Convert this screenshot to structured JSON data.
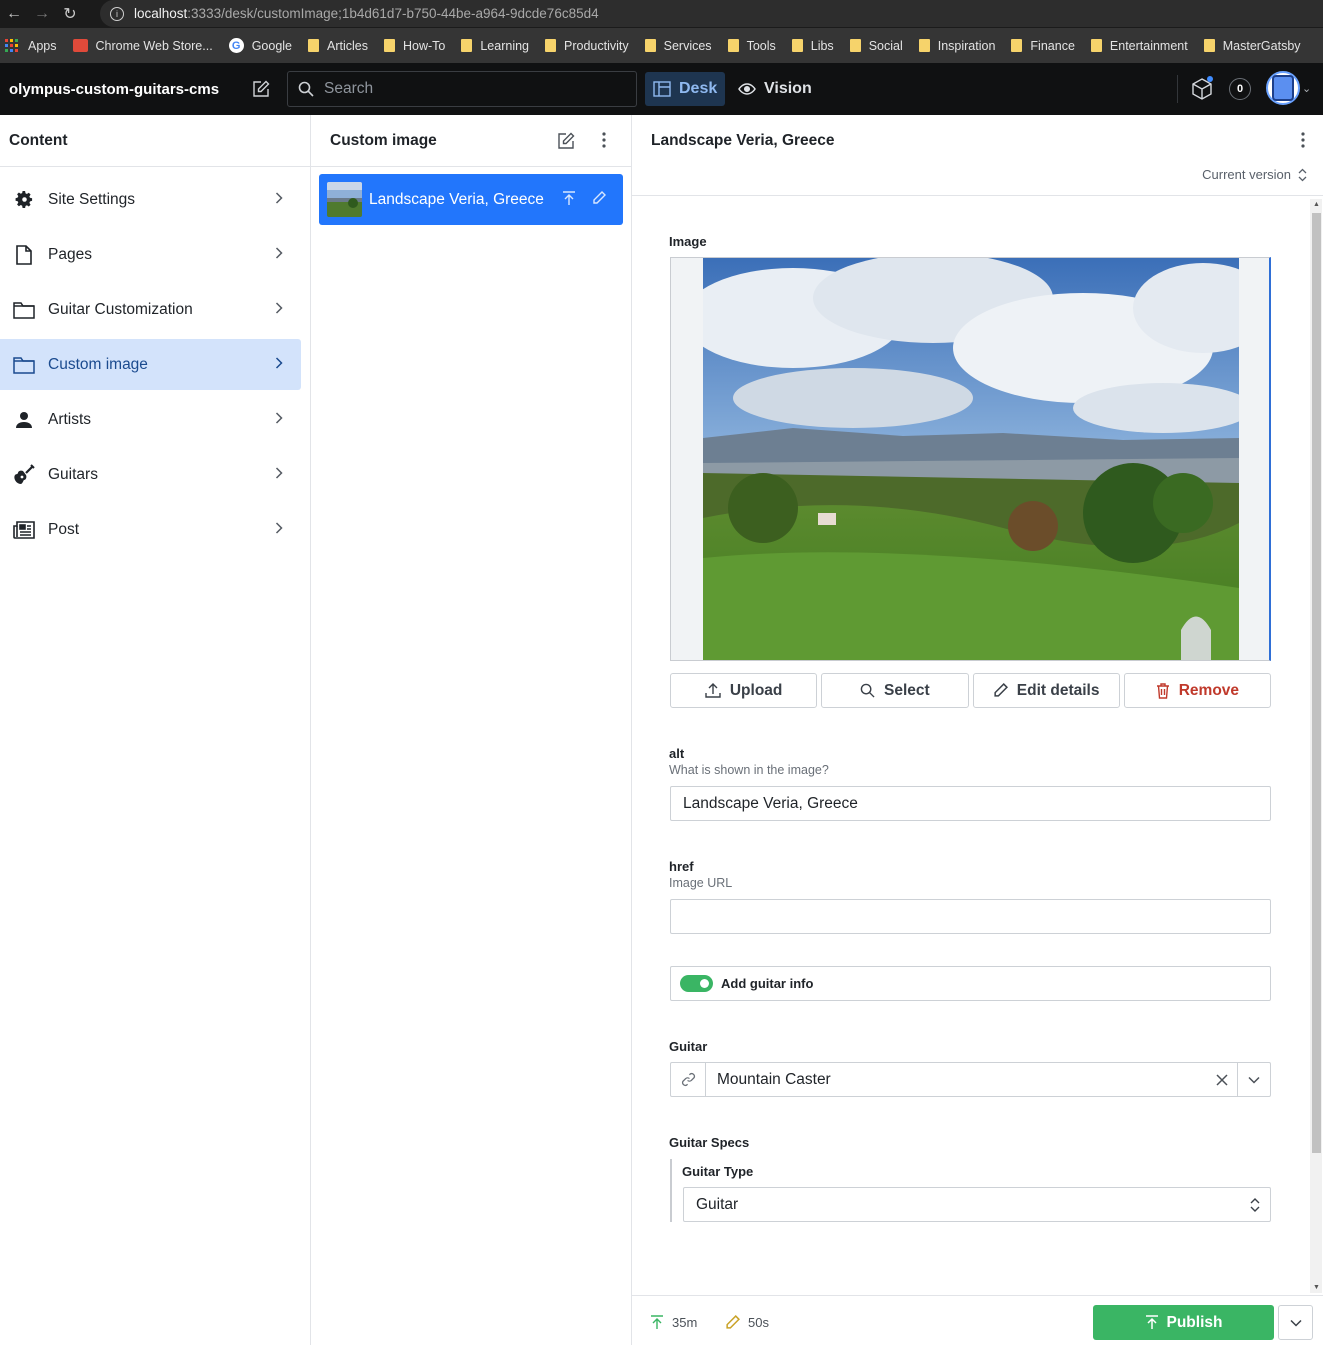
{
  "browser": {
    "url_host": "localhost",
    "url_rest": ":3333/desk/customImage;1b4d61d7-b750-44be-a964-9dcde76c85d4",
    "bookmarks": [
      {
        "label": "Apps",
        "icon": "apps-grid-icon"
      },
      {
        "label": "Chrome Web Store...",
        "icon": "chrome-store-icon"
      },
      {
        "label": "Google",
        "icon": "google-icon"
      },
      {
        "label": "Articles",
        "icon": "folder-icon"
      },
      {
        "label": "How-To",
        "icon": "folder-icon"
      },
      {
        "label": "Learning",
        "icon": "folder-icon"
      },
      {
        "label": "Productivity",
        "icon": "folder-icon"
      },
      {
        "label": "Services",
        "icon": "folder-icon"
      },
      {
        "label": "Tools",
        "icon": "folder-icon"
      },
      {
        "label": "Libs",
        "icon": "folder-icon"
      },
      {
        "label": "Social",
        "icon": "folder-icon"
      },
      {
        "label": "Inspiration",
        "icon": "folder-icon"
      },
      {
        "label": "Finance",
        "icon": "folder-icon"
      },
      {
        "label": "Entertainment",
        "icon": "folder-icon"
      },
      {
        "label": "MasterGatsby",
        "icon": "folder-icon"
      }
    ]
  },
  "appbar": {
    "brand": "olympus-custom-guitars-cms",
    "search_placeholder": "Search",
    "tools": [
      {
        "label": "Desk",
        "active": true
      },
      {
        "label": "Vision",
        "active": false
      }
    ],
    "notification_count": "0"
  },
  "content_pane": {
    "title": "Content",
    "items": [
      {
        "label": "Site Settings",
        "icon": "gear-icon",
        "active": false
      },
      {
        "label": "Pages",
        "icon": "document-icon",
        "active": false
      },
      {
        "label": "Guitar Customization",
        "icon": "folder-icon",
        "active": false
      },
      {
        "label": "Custom image",
        "icon": "folder-icon",
        "active": true
      },
      {
        "label": "Artists",
        "icon": "user-icon",
        "active": false
      },
      {
        "label": "Guitars",
        "icon": "guitar-icon",
        "active": false
      },
      {
        "label": "Post",
        "icon": "newspaper-icon",
        "active": false
      }
    ]
  },
  "list_pane": {
    "title": "Custom image",
    "documents": [
      {
        "title": "Landscape Veria, Greece",
        "selected": true
      }
    ]
  },
  "editor": {
    "title": "Landscape Veria, Greece",
    "version_label": "Current version",
    "image": {
      "label": "Image",
      "buttons": {
        "upload": "Upload",
        "select": "Select",
        "edit": "Edit details",
        "remove": "Remove"
      }
    },
    "alt": {
      "label": "alt",
      "description": "What is shown in the image?",
      "value": "Landscape Veria, Greece"
    },
    "href": {
      "label": "href",
      "description": "Image URL",
      "value": ""
    },
    "guitar_toggle": {
      "label": "Add guitar info",
      "checked": true
    },
    "guitar": {
      "label": "Guitar",
      "value": "Mountain Caster"
    },
    "guitar_specs": {
      "label": "Guitar Specs",
      "type_label": "Guitar Type",
      "type_value": "Guitar"
    },
    "footer": {
      "published_ago": "35m",
      "edited_ago": "50s",
      "publish_label": "Publish"
    }
  },
  "colors": {
    "accent": "#2276fc",
    "publish": "#3ab564",
    "danger": "#c0392b",
    "active_nav_bg": "#d3e3fb"
  }
}
